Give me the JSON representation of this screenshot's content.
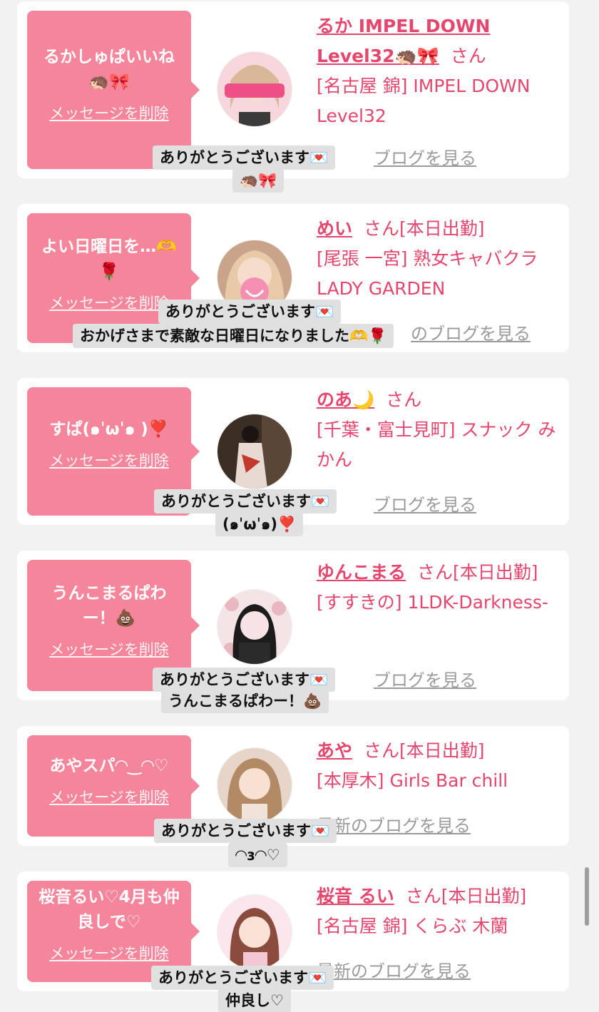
{
  "theme": {
    "accent": "#e5466d",
    "bubble": "#f4859a",
    "reply_bg": "#e0e0e0",
    "page_bg": "#f2f2f2"
  },
  "common": {
    "delete_label": "メッセージを削除",
    "blog_label": "最新のブログを見る",
    "san": "さん"
  },
  "cards": [
    {
      "bubble_lines": [
        "るかしゅぱいいね",
        "🦔🎀"
      ],
      "avatar": "avatar-photo",
      "name": "るか IMPEL DOWN Level32🦔🎀",
      "name_suffix": "",
      "shop": "[名古屋 錦] IMPEL DOWN Level32",
      "blog_visible": "ブログを見る",
      "reply_lines": [
        "ありがとうございます💌",
        "🦔🎀"
      ]
    },
    {
      "bubble_lines": [
        "よい日曜日を…🫶",
        "🌹"
      ],
      "avatar": "avatar-photo",
      "name": "めい",
      "name_suffix": "[本日出勤]",
      "shop": "[尾張 一宮] 熟女キャバクラ LADY GARDEN",
      "blog_visible": "のブログを見る",
      "reply_lines": [
        "ありがとうございます💌",
        "おかげさまで素敵な日曜日になりました🫶🌹"
      ]
    },
    {
      "bubble_lines": [
        "すぱ(๑ˈωˈ๑ )❣️"
      ],
      "avatar": "avatar-photo",
      "name": "のあ🌙",
      "name_suffix": "",
      "shop": "[千葉・富士見町] スナック みかん",
      "blog_visible": "ブログを見る",
      "reply_lines": [
        "ありがとうございます💌",
        "(๑ˈωˈ๑)❣️"
      ]
    },
    {
      "bubble_lines": [
        "うんこまるぱわ",
        "ー！💩"
      ],
      "avatar": "avatar-photo",
      "name": "ゆんこまる",
      "name_suffix": "[本日出勤]",
      "shop": "[すすきの] 1LDK-Darkness-",
      "blog_visible": "ブログを見る",
      "reply_lines": [
        "ありがとうございます💌",
        "うんこまるぱわー！💩"
      ]
    },
    {
      "bubble_lines": [
        "あやスパ◠‿◠♡"
      ],
      "avatar": "avatar-photo",
      "name": "あや",
      "name_suffix": "[本日出勤]",
      "shop": "[本厚木] Girls Bar chill",
      "blog_visible": "最新のブログを見る",
      "reply_lines": [
        "ありがとうございます💌",
        "◠ɜ◠♡"
      ]
    },
    {
      "bubble_lines": [
        "桜音るい♡4月も仲",
        "良しで♡"
      ],
      "avatar": "avatar-photo",
      "name": "桜音 るい",
      "name_suffix": "[本日出勤]",
      "shop": "[名古屋 錦] くらぶ 木蘭",
      "blog_visible": "最新のブログを見る",
      "reply_lines": [
        "ありがとうございます💌",
        "仲良し♡"
      ]
    }
  ]
}
